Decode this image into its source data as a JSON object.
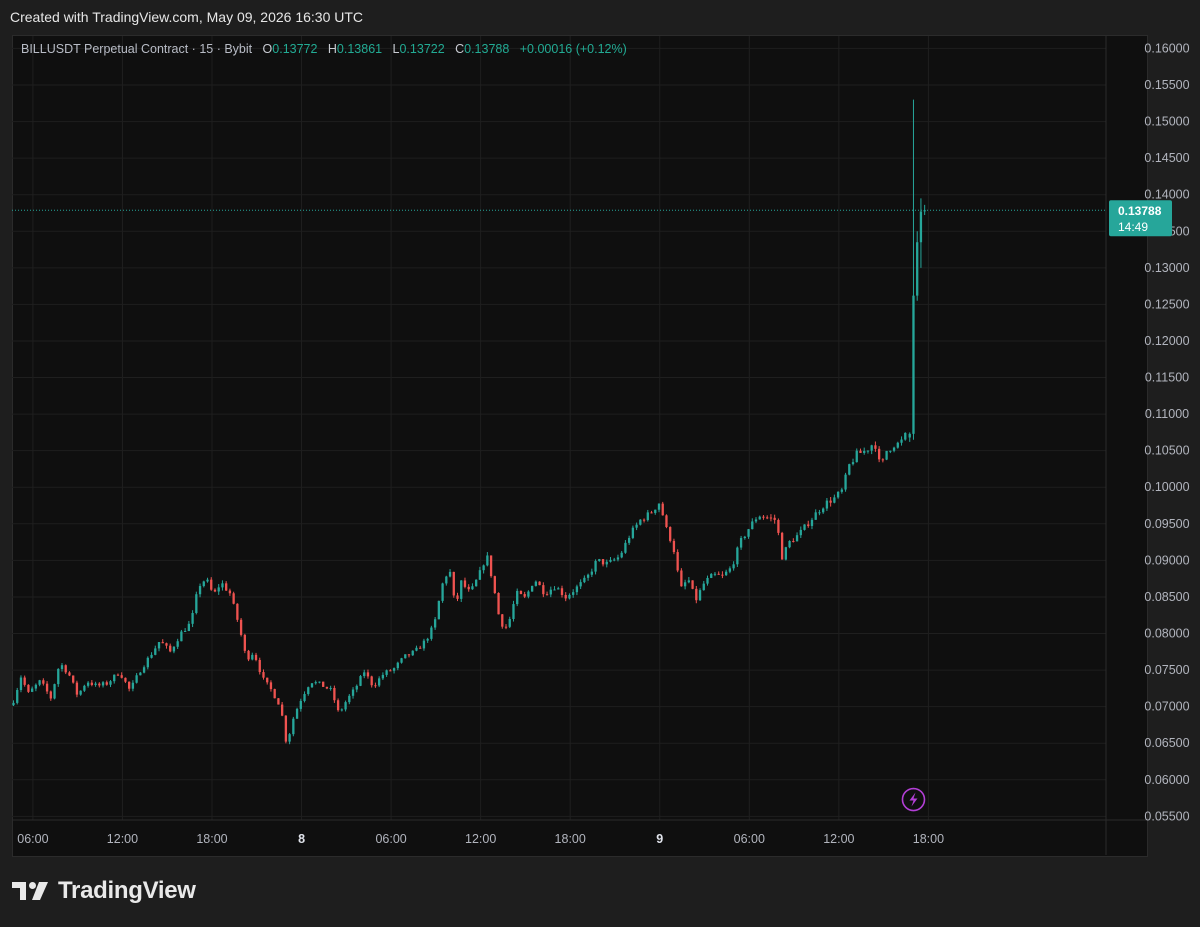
{
  "header": {
    "caption": "Created with TradingView.com, May 09, 2026 16:30 UTC"
  },
  "legend": {
    "symbol": "BILLUSDT Perpetual Contract · 15 · Bybit",
    "open_label": "O",
    "open": "0.13772",
    "high_label": "H",
    "high": "0.13861",
    "low_label": "L",
    "low": "0.13722",
    "close_label": "C",
    "close": "0.13788",
    "change": "+0.00016 (+0.12%)"
  },
  "price_tag": {
    "price": "0.13788",
    "countdown": "14:49"
  },
  "branding": {
    "name": "TradingView"
  },
  "colors": {
    "up": "#26a69a",
    "down": "#ef5350",
    "grid": "#1f1f1f",
    "axis_text": "#b2b5be",
    "alert": "#b33fd6"
  },
  "icons": {
    "alert": "lightning-icon",
    "logo": "tradingview-logo-icon"
  },
  "chart_data": {
    "type": "candlestick",
    "interval": "15",
    "y_ticks": [
      "0.16000",
      "0.15500",
      "0.15000",
      "0.14500",
      "0.14000",
      "0.13500",
      "0.13000",
      "0.12500",
      "0.12000",
      "0.11500",
      "0.11000",
      "0.10500",
      "0.10000",
      "0.09500",
      "0.09000",
      "0.08500",
      "0.08000",
      "0.07500",
      "0.07000",
      "0.06500",
      "0.06000",
      "0.05500"
    ],
    "ylim": [
      0.0545,
      0.1617
    ],
    "x_ticks": [
      {
        "label": "06:00",
        "t": 6
      },
      {
        "label": "12:00",
        "t": 12
      },
      {
        "label": "18:00",
        "t": 18
      },
      {
        "label": "8",
        "t": 24,
        "bold": true
      },
      {
        "label": "06:00",
        "t": 30
      },
      {
        "label": "12:00",
        "t": 36
      },
      {
        "label": "18:00",
        "t": 42
      },
      {
        "label": "9",
        "t": 48,
        "bold": true
      },
      {
        "label": "06:00",
        "t": 54
      },
      {
        "label": "12:00",
        "t": 60
      },
      {
        "label": "18:00",
        "t": 66
      }
    ],
    "x_unit": "hours from May 7 00:00 UTC",
    "xlim": [
      4.6,
      77.9
    ],
    "last_price": 0.13788,
    "price_path": [
      [
        4.6,
        0.0702
      ],
      [
        5.2,
        0.0741
      ],
      [
        5.7,
        0.0718
      ],
      [
        6.5,
        0.0735
      ],
      [
        7.2,
        0.0712
      ],
      [
        7.8,
        0.076
      ],
      [
        8.4,
        0.0745
      ],
      [
        9.0,
        0.0715
      ],
      [
        9.6,
        0.0735
      ],
      [
        10.3,
        0.0728
      ],
      [
        11.0,
        0.0732
      ],
      [
        11.8,
        0.0748
      ],
      [
        12.5,
        0.0722
      ],
      [
        13.2,
        0.075
      ],
      [
        13.8,
        0.0768
      ],
      [
        14.5,
        0.079
      ],
      [
        15.2,
        0.0775
      ],
      [
        15.9,
        0.08
      ],
      [
        16.6,
        0.0815
      ],
      [
        17.1,
        0.0865
      ],
      [
        17.6,
        0.0875
      ],
      [
        18.1,
        0.0852
      ],
      [
        18.6,
        0.087
      ],
      [
        19.2,
        0.0855
      ],
      [
        19.8,
        0.0812
      ],
      [
        20.3,
        0.0765
      ],
      [
        20.8,
        0.0775
      ],
      [
        21.4,
        0.0738
      ],
      [
        22.0,
        0.0722
      ],
      [
        22.6,
        0.07
      ],
      [
        23.0,
        0.0648
      ],
      [
        23.5,
        0.0688
      ],
      [
        24.0,
        0.0712
      ],
      [
        24.6,
        0.0735
      ],
      [
        25.3,
        0.073
      ],
      [
        26.0,
        0.0722
      ],
      [
        26.5,
        0.069
      ],
      [
        27.0,
        0.0708
      ],
      [
        27.6,
        0.0725
      ],
      [
        28.2,
        0.0748
      ],
      [
        28.8,
        0.0728
      ],
      [
        29.5,
        0.0745
      ],
      [
        30.2,
        0.0752
      ],
      [
        30.9,
        0.0768
      ],
      [
        31.6,
        0.0775
      ],
      [
        32.3,
        0.079
      ],
      [
        32.9,
        0.0812
      ],
      [
        33.4,
        0.0865
      ],
      [
        33.9,
        0.089
      ],
      [
        34.3,
        0.0835
      ],
      [
        34.7,
        0.087
      ],
      [
        35.3,
        0.0855
      ],
      [
        35.9,
        0.088
      ],
      [
        36.4,
        0.0908
      ],
      [
        36.8,
        0.0872
      ],
      [
        37.3,
        0.0815
      ],
      [
        37.8,
        0.0808
      ],
      [
        38.4,
        0.0855
      ],
      [
        39.0,
        0.0848
      ],
      [
        39.6,
        0.0875
      ],
      [
        40.3,
        0.0855
      ],
      [
        41.0,
        0.0865
      ],
      [
        41.7,
        0.085
      ],
      [
        42.4,
        0.0862
      ],
      [
        43.1,
        0.0875
      ],
      [
        43.8,
        0.09
      ],
      [
        44.5,
        0.0895
      ],
      [
        45.3,
        0.0905
      ],
      [
        46.0,
        0.0935
      ],
      [
        46.7,
        0.0955
      ],
      [
        47.4,
        0.0965
      ],
      [
        48.0,
        0.098
      ],
      [
        48.4,
        0.0945
      ],
      [
        48.9,
        0.092
      ],
      [
        49.4,
        0.086
      ],
      [
        49.9,
        0.0875
      ],
      [
        50.4,
        0.0845
      ],
      [
        51.0,
        0.087
      ],
      [
        51.6,
        0.088
      ],
      [
        52.2,
        0.0878
      ],
      [
        52.8,
        0.089
      ],
      [
        53.4,
        0.0925
      ],
      [
        54.0,
        0.0945
      ],
      [
        54.6,
        0.0962
      ],
      [
        55.3,
        0.0958
      ],
      [
        55.8,
        0.0955
      ],
      [
        56.2,
        0.0905
      ],
      [
        56.7,
        0.0925
      ],
      [
        57.3,
        0.0935
      ],
      [
        57.9,
        0.095
      ],
      [
        58.5,
        0.0965
      ],
      [
        59.1,
        0.0978
      ],
      [
        59.7,
        0.0985
      ],
      [
        60.2,
        0.0995
      ],
      [
        60.7,
        0.103
      ],
      [
        61.2,
        0.1045
      ],
      [
        61.8,
        0.105
      ],
      [
        62.4,
        0.1062
      ],
      [
        62.8,
        0.1025
      ],
      [
        63.2,
        0.105
      ],
      [
        63.7,
        0.1058
      ],
      [
        64.1,
        0.106
      ],
      [
        64.6,
        0.1075
      ],
      [
        64.85,
        0.126
      ],
      [
        65.05,
        0.1335
      ],
      [
        65.25,
        0.13
      ],
      [
        65.45,
        0.137
      ],
      [
        65.7,
        0.1379
      ]
    ],
    "wick_seeds": [
      {
        "t": 64.75,
        "low": 0.1065,
        "high": 0.153,
        "open": 0.107,
        "close": 0.1262
      }
    ],
    "alert_marker": {
      "t": 64.8,
      "price": 0.0573
    }
  }
}
